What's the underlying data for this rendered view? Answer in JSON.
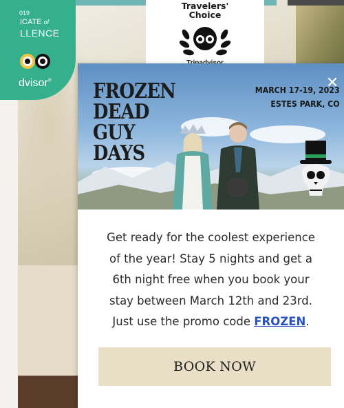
{
  "badges": {
    "certificate": {
      "year": "019",
      "line1": "ICATE",
      "line1_of": "of",
      "line2": "LLENCE",
      "brand": "dvisor",
      "brand_mark": "®"
    },
    "travelers_choice": {
      "title_line1": "Travelers'",
      "title_line2": "Choice",
      "subtitle": "Tripadvisor"
    }
  },
  "modal": {
    "close_glyph": "✕",
    "event_title": [
      "FROZEN",
      "DEAD",
      "GUY",
      "DAYS"
    ],
    "event_dates": "MARCH 17-19, 2023",
    "event_location": "ESTES PARK, CO",
    "promo": {
      "line1": "Get ready for the coolest experience",
      "line2": "of the year! Stay 5 nights and get a",
      "line3": "6th night free when you book your",
      "line4": "stay between March 12th and 23rd.",
      "line5_prefix": "Just use the promo code ",
      "code": "FROZEN",
      "line5_suffix": "."
    },
    "book_button": "BOOK NOW"
  },
  "colors": {
    "tripadvisor_green": "#34b08c",
    "promo_link": "#2a52be",
    "book_button_bg": "#e9dfc6",
    "footer_brown": "#5a3e2b"
  }
}
